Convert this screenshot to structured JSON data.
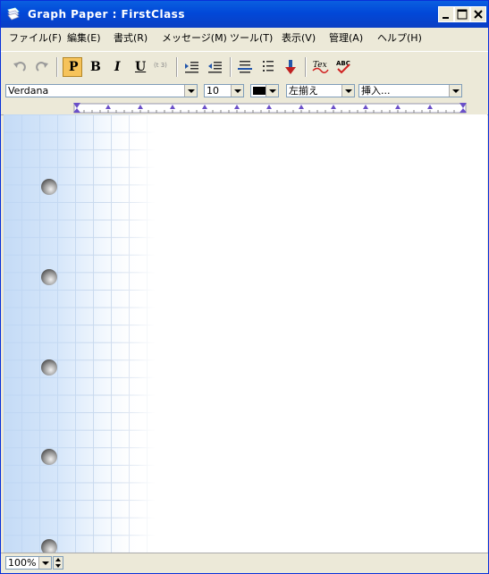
{
  "window": {
    "title": "Graph Paper : FirstClass"
  },
  "menu": {
    "items": [
      "ファイル(F)",
      "編集(E)",
      "書式(R)",
      "メッセージ(M)",
      "ツール(T)",
      "表示(V)",
      "管理(A)",
      "ヘルプ(H)"
    ]
  },
  "toolbar": {
    "plain_label": "P",
    "bold_label": "B",
    "italic_label": "I",
    "underline_label": "U",
    "superscript_label": "(t 3)"
  },
  "format": {
    "font": "Verdana",
    "size": "10",
    "color": "#000000",
    "align": "左揃え",
    "insert": "挿入..."
  },
  "status": {
    "zoom": "100%"
  },
  "colors": {
    "title_bar": "#0148d8",
    "active_button": "#f6c35a",
    "grid": "#b7c9e2"
  }
}
